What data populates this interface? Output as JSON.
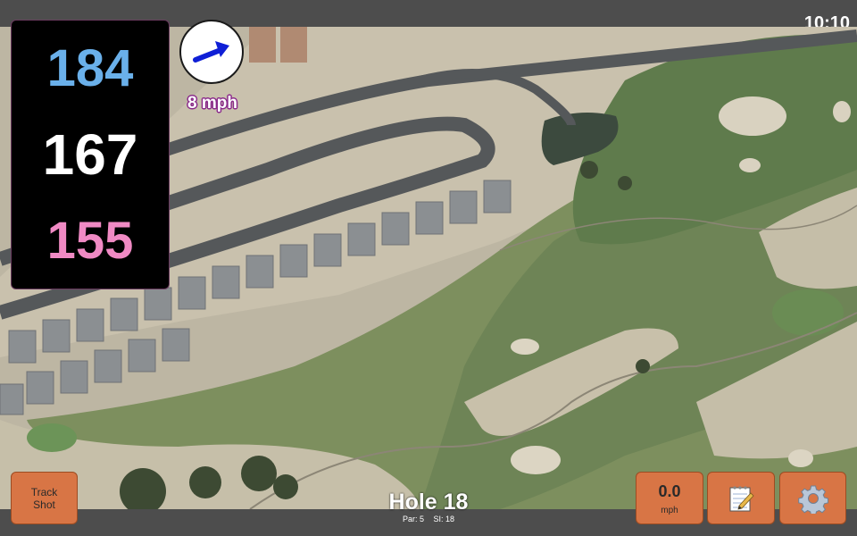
{
  "status": {
    "time": "10:10"
  },
  "distances": {
    "back": "184",
    "middle": "167",
    "front": "155"
  },
  "wind": {
    "speed": "8 mph",
    "icon": "wind-arrow-icon",
    "direction": "east-northeast"
  },
  "hole": {
    "title": "Hole 18",
    "par": "Par: 5",
    "stroke_index": "SI: 18"
  },
  "buttons": {
    "track_shot_line1": "Track",
    "track_shot_line2": "Shot",
    "speed_value": "0.0",
    "speed_unit": "mph",
    "notes_icon": "notepad-icon",
    "settings_icon": "gear-icon"
  },
  "colors": {
    "back": "#6ab0ea",
    "middle": "#ffffff",
    "front": "#f08ac4",
    "button": "#d87545",
    "panel": "#000000"
  }
}
